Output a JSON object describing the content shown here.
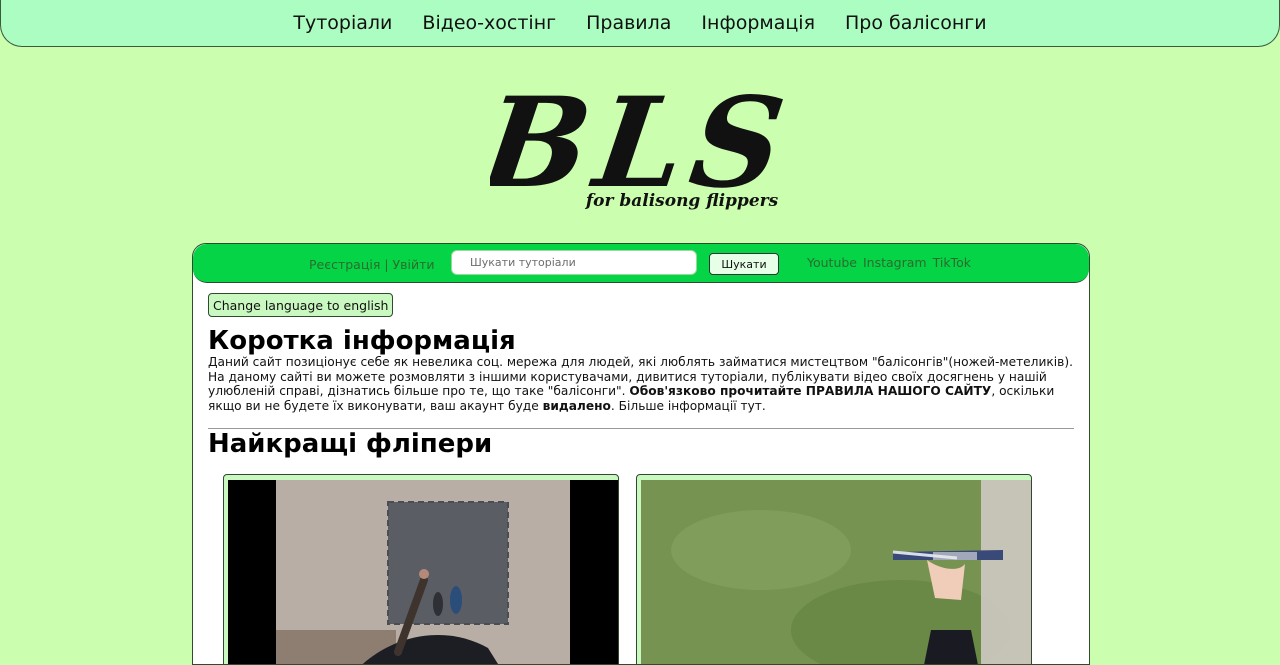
{
  "nav": {
    "items": [
      "Туторіали",
      "Відео-хостінг",
      "Правила",
      "Інформація",
      "Про балісонги"
    ]
  },
  "logo": {
    "title": "BLS",
    "subtitle": "for balisong flippers"
  },
  "toolbar": {
    "register_label": "Реєстрація",
    "separator": "|",
    "login_label": "Увійти",
    "search_placeholder": "Шукати туторіали",
    "search_button": "Шукати",
    "socials": [
      "Youtube",
      "Instagram",
      "TikTok"
    ]
  },
  "content": {
    "language_button": "Change language to english",
    "info_heading": "Коротка інформація",
    "info_text_part1": "Даний сайт позиціонує себе як невелика соц. мережа для людей, які люблять займатися мистецтвом \"балісонгів\"(ножей-метеликів). На даному сайті ви можете розмовляти з іншими користувачами, дивитися туторіали, публікувати відео своїх досягнень у нашій улюбленій справі, дізнатись більше про те, що таке \"балісонги\". ",
    "info_text_bold1": "Обов'язково прочитайте ПРАВИЛА НАШОГО САЙТУ",
    "info_text_part2": ", оскільки якщо ви не будете їх виконувати, ваш акаунт буде ",
    "info_text_bold2": "видалено",
    "info_text_part3": ". Більше інформації тут.",
    "best_heading": "Найкращі фліпери"
  },
  "colors": {
    "page_bg": "#cbffaf",
    "nav_bg": "#acfdc2",
    "bar_bg": "#04d445",
    "card_bg": "#c9f9c1"
  }
}
